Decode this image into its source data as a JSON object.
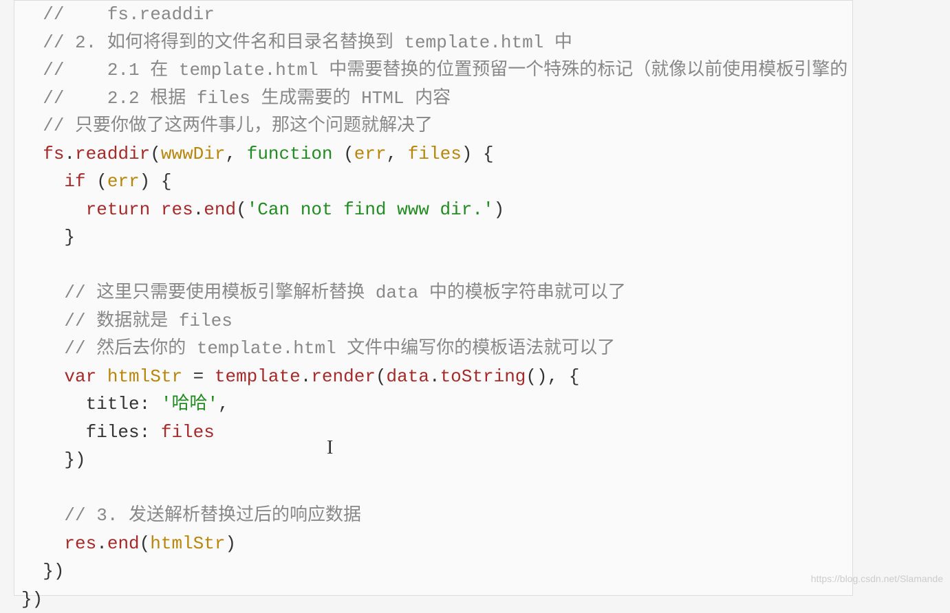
{
  "code": {
    "l1_indent": "  ",
    "l1_comment": "//    fs.readdir",
    "l2_indent": "  ",
    "l2_comment": "// 2. 如何将得到的文件名和目录名替换到 template.html 中",
    "l3_indent": "  ",
    "l3_comment": "//    2.1 在 template.html 中需要替换的位置预留一个特殊的标记（就像以前使用模板引擎的",
    "l4_indent": "  ",
    "l4_comment": "//    2.2 根据 files 生成需要的 HTML 内容",
    "l5_indent": "  ",
    "l5_comment": "// 只要你做了这两件事儿，那这个问题就解决了",
    "l6_indent": "  ",
    "l6_fs": "fs",
    "l6_dot": ".",
    "l6_readdir": "readdir",
    "l6_paren1": "(",
    "l6_wwwDir": "wwwDir",
    "l6_comma": ", ",
    "l6_function": "function",
    "l6_space": " ",
    "l6_paren2": "(",
    "l6_err": "err",
    "l6_comma2": ", ",
    "l6_files": "files",
    "l6_paren3": ") {",
    "l7_indent": "    ",
    "l7_if": "if",
    "l7_rest": " (",
    "l7_err": "err",
    "l7_close": ") {",
    "l8_indent": "      ",
    "l8_return": "return",
    "l8_space": " ",
    "l8_res": "res",
    "l8_dot": ".",
    "l8_end": "end",
    "l8_paren": "(",
    "l8_string": "'Can not find www dir.'",
    "l8_close": ")",
    "l9_indent": "    ",
    "l9_close": "}",
    "l11_indent": "    ",
    "l11_comment": "// 这里只需要使用模板引擎解析替换 data 中的模板字符串就可以了",
    "l12_indent": "    ",
    "l12_comment": "// 数据就是 files",
    "l13_indent": "    ",
    "l13_comment": "// 然后去你的 template.html 文件中编写你的模板语法就可以了",
    "l14_indent": "    ",
    "l14_var": "var",
    "l14_space": " ",
    "l14_htmlStr": "htmlStr",
    "l14_eq": " = ",
    "l14_template": "template",
    "l14_dot": ".",
    "l14_render": "render",
    "l14_paren": "(",
    "l14_data": "data",
    "l14_dot2": ".",
    "l14_toString": "toString",
    "l14_paren2": "(), {",
    "l15_indent": "      ",
    "l15_title": "title: ",
    "l15_string": "'哈哈'",
    "l15_comma": ",",
    "l16_indent": "      ",
    "l16_files": "files: ",
    "l16_filesval": "files",
    "l17_indent": "    ",
    "l17_close": "})",
    "l19_indent": "    ",
    "l19_comment": "// 3. 发送解析替换过后的响应数据",
    "l20_indent": "    ",
    "l20_res": "res",
    "l20_dot": ".",
    "l20_end": "end",
    "l20_paren": "(",
    "l20_htmlStr": "htmlStr",
    "l20_close": ")",
    "l21_indent": "  ",
    "l21_close": "})",
    "l22_indent": "",
    "l22_close": "})"
  },
  "watermark": "https://blog.csdn.net/Slamande",
  "cursor": "I"
}
